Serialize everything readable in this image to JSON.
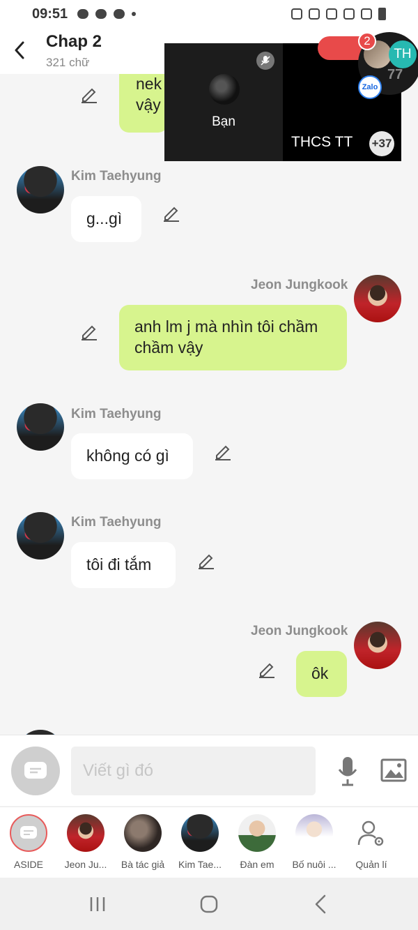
{
  "status": {
    "time": "09:51"
  },
  "header": {
    "title": "Chap 2",
    "subtitle": "321 chữ"
  },
  "messages": [
    {
      "side": "right",
      "speaker": "",
      "text": "nek vậy",
      "partial": true
    },
    {
      "side": "left",
      "speaker": "Kim Taehyung",
      "text": "g...gì"
    },
    {
      "side": "right",
      "speaker": "Jeon Jungkook",
      "text": "anh lm j mà nhìn tôi chầm chầm vậy"
    },
    {
      "side": "left",
      "speaker": "Kim Taehyung",
      "text": "không có gì"
    },
    {
      "side": "left",
      "speaker": "Kim Taehyung",
      "text": "tôi đi tắm"
    },
    {
      "side": "right",
      "speaker": "Jeon Jungkook",
      "text": "ôk"
    }
  ],
  "call": {
    "self_label": "Bạn",
    "group_name": "THCS TT",
    "more_count": "+37"
  },
  "zalo": {
    "badge": "2",
    "initials": "TH",
    "count": "77",
    "logo": "Zalo"
  },
  "composer": {
    "placeholder": "Viết gì đó"
  },
  "characters": [
    {
      "label": "ASIDE"
    },
    {
      "label": "Jeon Ju..."
    },
    {
      "label": "Bà tác giả"
    },
    {
      "label": "Kim Tae..."
    },
    {
      "label": "Đàn em"
    },
    {
      "label": "Bố nuôi ..."
    },
    {
      "label": "Quản lí"
    }
  ],
  "colors": {
    "right_bubble": "#d7f48e",
    "left_bubble": "#ffffff",
    "accent_red": "#e84a4a",
    "background": "#f5f5f5"
  }
}
